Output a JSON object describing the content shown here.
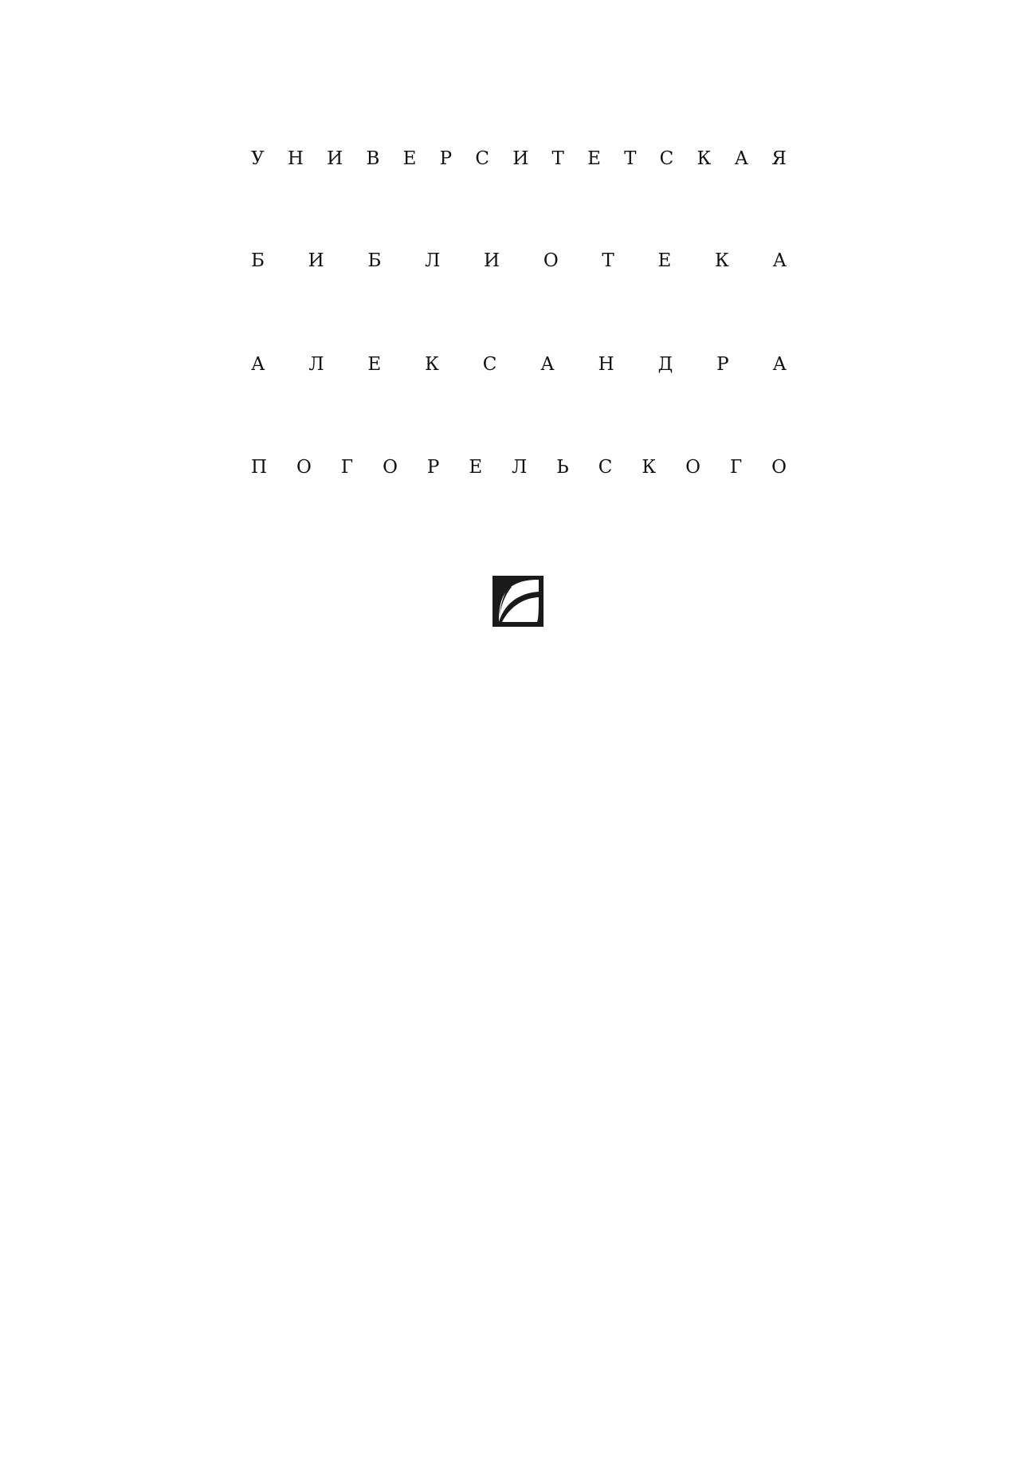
{
  "series_title": {
    "lines": [
      "УНИВЕРСИТЕТСКАЯ",
      "БИБЛИОТЕКА",
      "АЛЕКСАНДРА",
      "ПОГОРЕЛЬСКОГО"
    ]
  },
  "emblem": {
    "icon": "publisher-logo-icon",
    "color": "#1a1a1a"
  }
}
